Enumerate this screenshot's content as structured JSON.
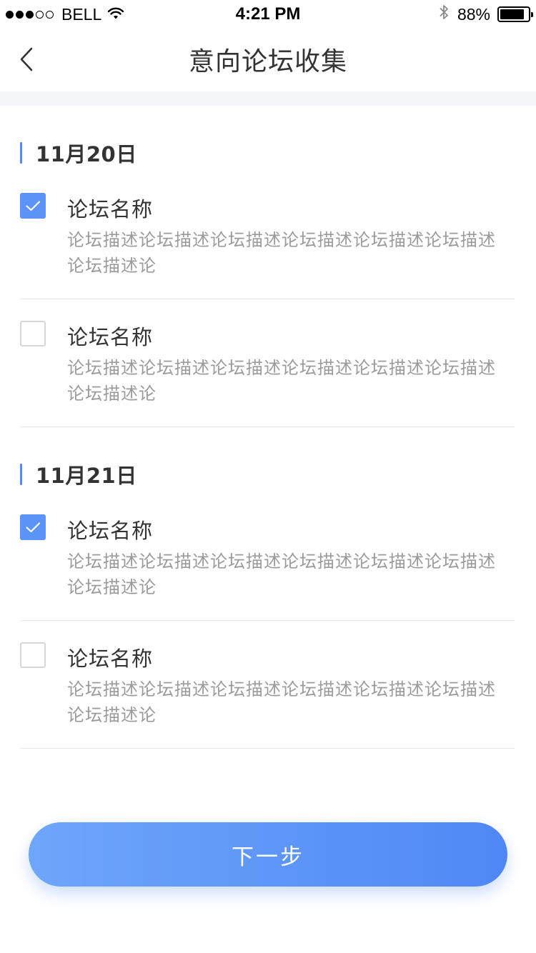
{
  "status_bar": {
    "carrier": "BELL",
    "time": "4:21 PM",
    "battery_percent": "88%",
    "battery_level": 0.88,
    "signal_bars_filled": 3,
    "signal_bars_total": 5,
    "icons": [
      "wifi-icon",
      "bluetooth-icon",
      "battery-icon"
    ]
  },
  "nav": {
    "title": "意向论坛收集",
    "back_icon": "chevron-left-icon"
  },
  "sections": [
    {
      "date": "11月20日",
      "items": [
        {
          "name": "论坛名称",
          "description": "论坛描述论坛描述论坛描述论坛描述论坛描述论坛描述论坛描述论",
          "checked": true
        },
        {
          "name": "论坛名称",
          "description": "论坛描述论坛描述论坛描述论坛描述论坛描述论坛描述论坛描述论",
          "checked": false
        }
      ]
    },
    {
      "date": "11月21日",
      "items": [
        {
          "name": "论坛名称",
          "description": "论坛描述论坛描述论坛描述论坛描述论坛描述论坛描述论坛描述论",
          "checked": true
        },
        {
          "name": "论坛名称",
          "description": "论坛描述论坛描述论坛描述论坛描述论坛描述论坛描述论坛描述论",
          "checked": false
        }
      ]
    }
  ],
  "footer": {
    "next_label": "下一步"
  },
  "colors": {
    "accent": "#5b93f7",
    "button_gradient_start": "#6ea6fb",
    "button_gradient_end": "#4f88f5",
    "text_primary": "#333333",
    "text_secondary": "#9b9b9b",
    "divider": "#e8e8e8"
  }
}
